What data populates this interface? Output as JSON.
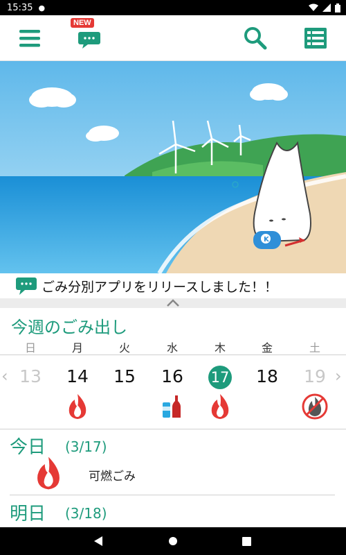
{
  "status_bar": {
    "time": "15:35"
  },
  "toolbar": {
    "menu_icon": "hamburger-menu-icon",
    "news_badge": "NEW",
    "search_icon": "search-icon",
    "list_icon": "list-icon"
  },
  "news": {
    "text": "ごみ分別アプリをリリースしました！！"
  },
  "week": {
    "title": "今週のごみ出し",
    "weekdays": [
      "日",
      "月",
      "火",
      "水",
      "木",
      "金",
      "土"
    ],
    "dates": [
      "13",
      "14",
      "15",
      "16",
      "17",
      "18",
      "19"
    ],
    "today_index": 4
  },
  "today": {
    "heading": "今日",
    "date": "(3/17)",
    "garbage": "可燃ごみ"
  },
  "tomorrow": {
    "heading": "明日",
    "date": "(3/18)"
  },
  "colors": {
    "accent": "#1e9b7c",
    "fire": "#e53935"
  }
}
